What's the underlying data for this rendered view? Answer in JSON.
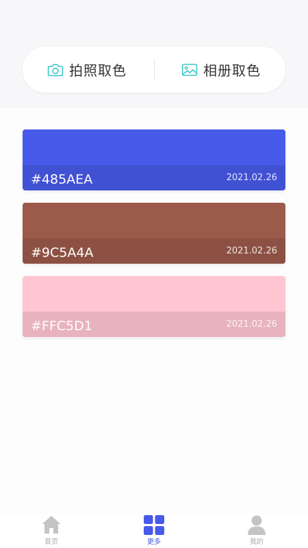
{
  "picker": {
    "camera_label": "拍照取色",
    "album_label": "相册取色",
    "icon_color": "#3cc7c9"
  },
  "colors": [
    {
      "hex": "#485AEA",
      "date": "2021.02.26",
      "color": "#485AEA"
    },
    {
      "hex": "#9C5A4A",
      "date": "2021.02.26",
      "color": "#9C5A4A"
    },
    {
      "hex": "#FFC5D1",
      "date": "2021.02.26",
      "color": "#FFC5D1"
    }
  ],
  "nav": {
    "items": [
      {
        "label": "首页",
        "icon": "home-icon",
        "active": false
      },
      {
        "label": "更多",
        "icon": "grid-icon",
        "active": true
      },
      {
        "label": "我的",
        "icon": "user-icon",
        "active": false
      }
    ],
    "active_color": "#485AEA",
    "inactive_color": "#c4c4c4"
  }
}
